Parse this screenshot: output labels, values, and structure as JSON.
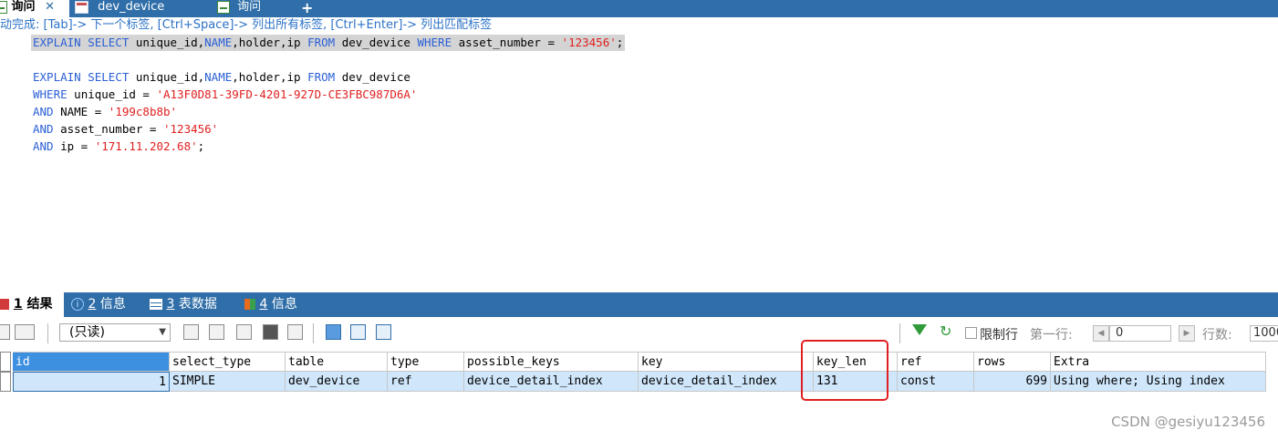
{
  "tabs": [
    {
      "label": "询问",
      "close": "✕",
      "active": true
    },
    {
      "label": "dev_device",
      "active": false
    },
    {
      "label": "询问",
      "active": false
    }
  ],
  "tab_add": "+",
  "hint": "动完成: [Tab]-> 下一个标签, [Ctrl+Space]-> 列出所有标签, [Ctrl+Enter]-> 列出匹配标签",
  "editor": {
    "line1": {
      "kw1": "EXPLAIN SELECT",
      "cols1": " unique_id,",
      "name": "NAME",
      "cols2": ",holder,ip ",
      "from": "FROM",
      "table": " dev_device ",
      "where": "WHERE",
      "col": " asset_number = ",
      "val": "'123456'",
      "end": ";"
    },
    "line3": {
      "kw1": "EXPLAIN SELECT",
      "cols1": " unique_id,",
      "name": "NAME",
      "cols2": ",holder,ip ",
      "from": "FROM",
      "table": " dev_device"
    },
    "line4": {
      "kw": "WHERE",
      "col": " unique_id = ",
      "val": "'A13F0D81-39FD-4201-927D-CE3FBC987D6A'"
    },
    "line5": {
      "kw": "AND",
      "col": " NAME = ",
      "val": "'199c8b8b'"
    },
    "line6": {
      "kw": "AND",
      "col": " asset_number = ",
      "val": "'123456'"
    },
    "line7": {
      "kw": "AND",
      "col": " ip = ",
      "val": "'171.11.202.68'",
      "end": ";"
    }
  },
  "result_tabs": [
    {
      "num": "1",
      "label": "结果",
      "active": true
    },
    {
      "num": "2",
      "label": "信息",
      "active": false
    },
    {
      "num": "3",
      "label": "表数据",
      "active": false
    },
    {
      "num": "4",
      "label": "信息",
      "active": false
    }
  ],
  "toolbar": {
    "mode": "(只读)",
    "limit_label": "限制行",
    "first_row_label": "第一行:",
    "first_row_value": "0",
    "rows_label": "行数:",
    "rows_value": "1000"
  },
  "grid": {
    "columns": [
      "id",
      "select_type",
      "table",
      "type",
      "possible_keys",
      "key",
      "key_len",
      "ref",
      "rows",
      "Extra"
    ],
    "rows": [
      [
        "1",
        "SIMPLE",
        "dev_device",
        "ref",
        "device_detail_index",
        "device_detail_index",
        "131",
        "const",
        "699",
        "Using where; Using index"
      ]
    ]
  },
  "watermark": "CSDN @gesiyu123456",
  "colors": {
    "accent": "#2f6ea8",
    "keyword": "#2a5fd6",
    "string": "#e01f1f",
    "highlight": "#e02020"
  }
}
